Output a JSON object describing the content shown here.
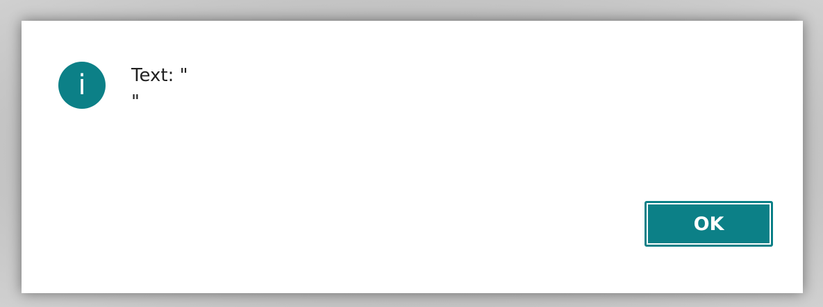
{
  "dialog": {
    "icon": "info-icon",
    "icon_glyph": "i",
    "message_line1": "Text: \"",
    "message_line2": "\"",
    "ok_label": "OK"
  },
  "colors": {
    "accent": "#0c8087",
    "background": "#ffffff",
    "text": "#212121"
  }
}
